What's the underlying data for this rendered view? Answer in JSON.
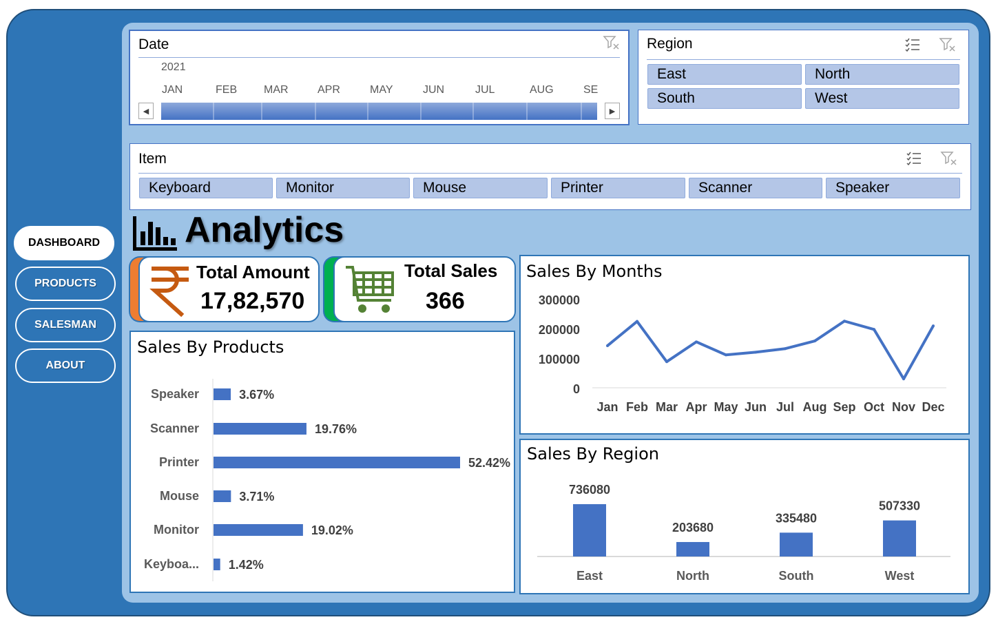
{
  "nav": {
    "items": [
      {
        "label": "DASHBOARD",
        "active": true
      },
      {
        "label": "PRODUCTS",
        "active": false
      },
      {
        "label": "SALESMAN",
        "active": false
      },
      {
        "label": "ABOUT",
        "active": false
      }
    ]
  },
  "date_slicer": {
    "title": "Date",
    "year": "2021",
    "months": [
      "JAN",
      "FEB",
      "MAR",
      "APR",
      "MAY",
      "JUN",
      "JUL",
      "AUG",
      "SE"
    ]
  },
  "region_slicer": {
    "title": "Region",
    "options": [
      "East",
      "North",
      "South",
      "West"
    ]
  },
  "item_slicer": {
    "title": "Item",
    "options": [
      "Keyboard",
      "Monitor",
      "Mouse",
      "Printer",
      "Scanner",
      "Speaker"
    ]
  },
  "heading": {
    "title": "Analytics"
  },
  "kpis": {
    "total_amount": {
      "label": "Total Amount",
      "value": "17,82,570",
      "icon": "rupee-icon"
    },
    "total_sales": {
      "label": "Total Sales",
      "value": "366",
      "icon": "shopping-cart-icon"
    }
  },
  "colors": {
    "frame": "#2e75b6",
    "inner": "#9dc3e6",
    "series": "#4472c4",
    "amount_accent": "#ed7d31",
    "sales_accent": "#00b050",
    "cart": "#548235",
    "rupee": "#c55a11"
  },
  "chart_data": [
    {
      "type": "bar",
      "orientation": "horizontal",
      "title": "Sales By Products",
      "categories": [
        "Speaker",
        "Scanner",
        "Printer",
        "Mouse",
        "Monitor",
        "Keyboa..."
      ],
      "values": [
        3.67,
        19.76,
        52.42,
        3.71,
        19.02,
        1.42
      ],
      "data_labels": [
        "3.67%",
        "19.76%",
        "52.42%",
        "3.71%",
        "19.02%",
        "1.42%"
      ],
      "grid": false
    },
    {
      "type": "line",
      "title": "Sales By Months",
      "x": [
        "Jan",
        "Feb",
        "Mar",
        "Apr",
        "May",
        "Jun",
        "Jul",
        "Aug",
        "Sep",
        "Oct",
        "Nov",
        "Dec"
      ],
      "values": [
        142000,
        224000,
        88000,
        155000,
        111000,
        120000,
        132000,
        158000,
        225000,
        197000,
        30000,
        209000
      ],
      "yticks": [
        "300000",
        "200000",
        "100000",
        "0"
      ],
      "ylim": [
        0,
        300000
      ],
      "grid": false
    },
    {
      "type": "bar",
      "title": "Sales By Region",
      "categories": [
        "East",
        "North",
        "South",
        "West"
      ],
      "values": [
        736080,
        203680,
        335480,
        507330
      ],
      "data_labels": [
        "736080",
        "203680",
        "335480",
        "507330"
      ],
      "grid": false
    }
  ]
}
